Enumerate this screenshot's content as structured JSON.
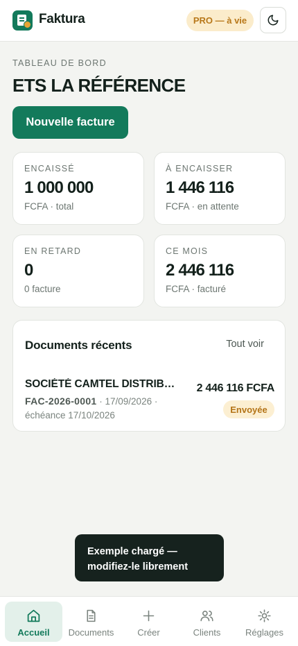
{
  "header": {
    "brand": "Faktura",
    "plan_badge": "PRO — à vie"
  },
  "dashboard": {
    "eyebrow": "TABLEAU DE BORD",
    "company": "ETS LA RÉFÉRENCE",
    "new_invoice_label": "Nouvelle facture"
  },
  "stats": [
    {
      "label": "ENCAISSÉ",
      "value": "1 000 000",
      "sub": "FCFA · total"
    },
    {
      "label": "À ENCAISSER",
      "value": "1 446 116",
      "sub": "FCFA · en attente"
    },
    {
      "label": "EN RETARD",
      "value": "0",
      "sub": "0 facture"
    },
    {
      "label": "CE MOIS",
      "value": "2 446 116",
      "sub": "FCFA · facturé"
    }
  ],
  "recent": {
    "title": "Documents récents",
    "see_all": "Tout voir",
    "items": [
      {
        "client": "SOCIÉTÉ CAMTEL DISTRIBUTION",
        "number": "FAC-2026-0001",
        "date": " · 17/09/2026 · échéance 17/10/2026",
        "amount": "2 446 116 FCFA",
        "status": "Envoyée"
      }
    ]
  },
  "toast": {
    "line1": "Exemple chargé —",
    "line2": "modifiez-le librement"
  },
  "nav": [
    {
      "label": "Accueil",
      "icon": "home-icon",
      "active": true
    },
    {
      "label": "Documents",
      "icon": "document-icon",
      "active": false
    },
    {
      "label": "Créer",
      "icon": "plus-icon",
      "active": false
    },
    {
      "label": "Clients",
      "icon": "users-icon",
      "active": false
    },
    {
      "label": "Réglages",
      "icon": "gear-icon",
      "active": false
    }
  ],
  "colors": {
    "accent": "#137a5b",
    "warning_bg": "#fbeccb",
    "warning_text": "#b8781a",
    "background": "#f3f4f1"
  }
}
